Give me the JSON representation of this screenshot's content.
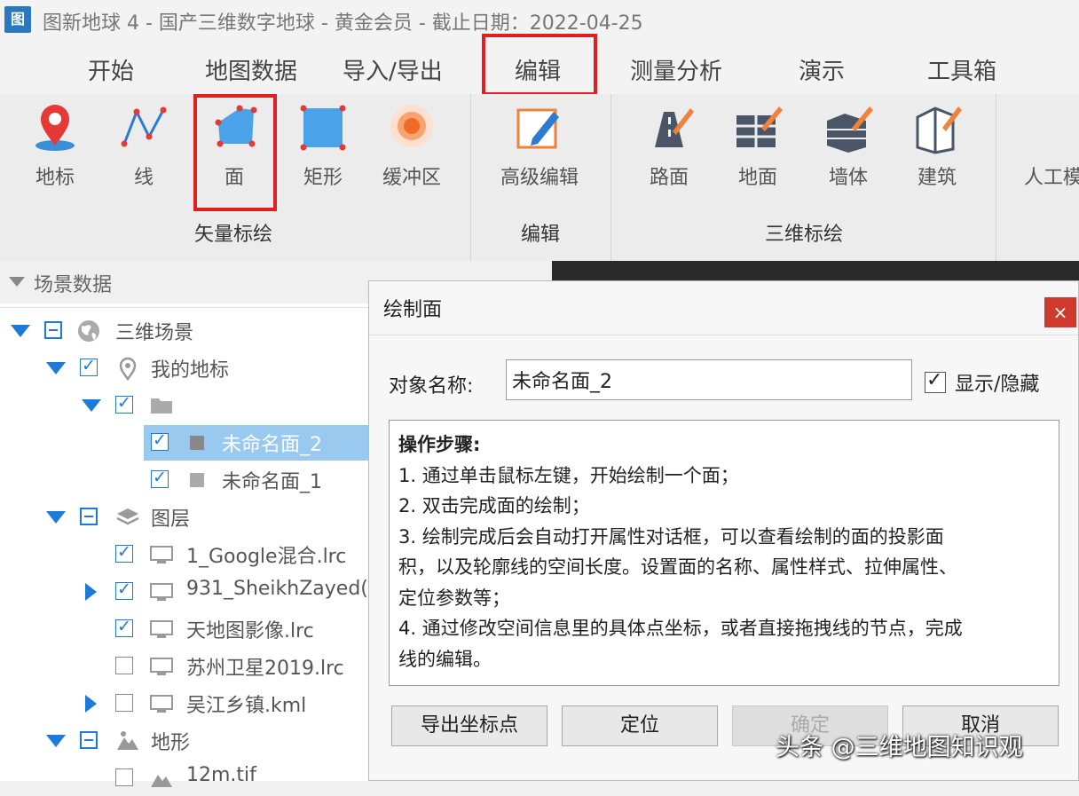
{
  "window": {
    "logo_text": "图",
    "title": "图新地球 4 - 国产三维数字地球 - 黄金会员 - 截止日期：2022-04-25"
  },
  "tabs": [
    "开始",
    "地图数据",
    "导入/导出",
    "编辑",
    "测量分析",
    "演示",
    "工具箱"
  ],
  "ribbon": {
    "vector": {
      "group_label": "矢量标绘",
      "buttons": [
        "地标",
        "线",
        "面",
        "矩形",
        "缓冲区"
      ]
    },
    "edit": {
      "group_label": "编辑",
      "buttons": [
        "高级编辑"
      ]
    },
    "three_d": {
      "group_label": "三维标绘",
      "buttons": [
        "路面",
        "地面",
        "墙体",
        "建筑"
      ]
    },
    "extra": {
      "partial_label": "人工模"
    }
  },
  "highlight_color": "#e02020",
  "scene_panel": {
    "title": "场景数据",
    "tree": [
      {
        "label": "三维场景"
      },
      {
        "label": "我的地标"
      },
      {
        "label": ""
      },
      {
        "label": "未命名面_2"
      },
      {
        "label": "未命名面_1"
      },
      {
        "label": "图层"
      },
      {
        "label": "1_Google混合.lrc"
      },
      {
        "label": "931_SheikhZayed("
      },
      {
        "label": "天地图影像.lrc"
      },
      {
        "label": "苏州卫星2019.lrc"
      },
      {
        "label": "吴江乡镇.kml"
      },
      {
        "label": "地形"
      },
      {
        "label": "12m.tif"
      }
    ]
  },
  "dialog": {
    "title": "绘制面",
    "close": "×",
    "name_label": "对象名称:",
    "name_value": "未命名面_2",
    "show_hide_label": "显示/隐藏",
    "steps": [
      "操作步骤:",
      "1. 通过单击鼠标左键，开始绘制一个面；",
      "2. 双击完成面的绘制；",
      "3. 绘制完成后会自动打开属性对话框，可以查看绘制的面的投影面",
      "积，以及轮廓线的空间长度。设置面的名称、属性样式、拉伸属性、",
      "定位参数等；",
      "4. 通过修改空间信息里的具体点坐标，或者直接拖拽线的节点，完成",
      "线的编辑。"
    ],
    "buttons": {
      "export": "导出坐标点",
      "locate": "定位",
      "ok": "确定",
      "cancel": "取消"
    }
  },
  "watermark": "头条 @三维地图知识观"
}
